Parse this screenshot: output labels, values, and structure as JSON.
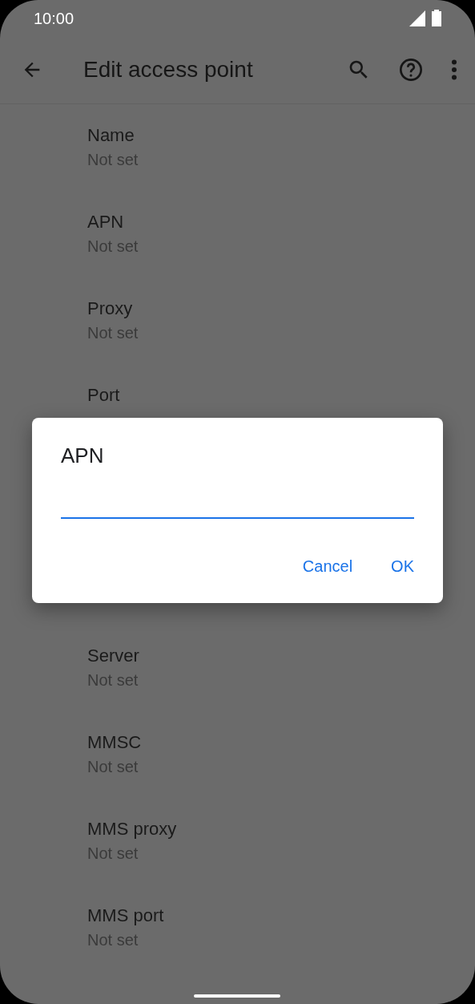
{
  "status_bar": {
    "time": "10:00"
  },
  "app_bar": {
    "title": "Edit access point"
  },
  "settings_above_dialog": [
    {
      "title": "Name",
      "value": "Not set"
    },
    {
      "title": "APN",
      "value": "Not set"
    },
    {
      "title": "Proxy",
      "value": "Not set"
    },
    {
      "title": "Port"
    }
  ],
  "settings_below_dialog": [
    {
      "title": "Server",
      "value": "Not set"
    },
    {
      "title": "MMSC",
      "value": "Not set"
    },
    {
      "title": "MMS proxy",
      "value": "Not set"
    },
    {
      "title": "MMS port",
      "value": "Not set"
    }
  ],
  "dialog": {
    "title": "APN",
    "buttons": [
      "Cancel",
      "OK"
    ]
  }
}
